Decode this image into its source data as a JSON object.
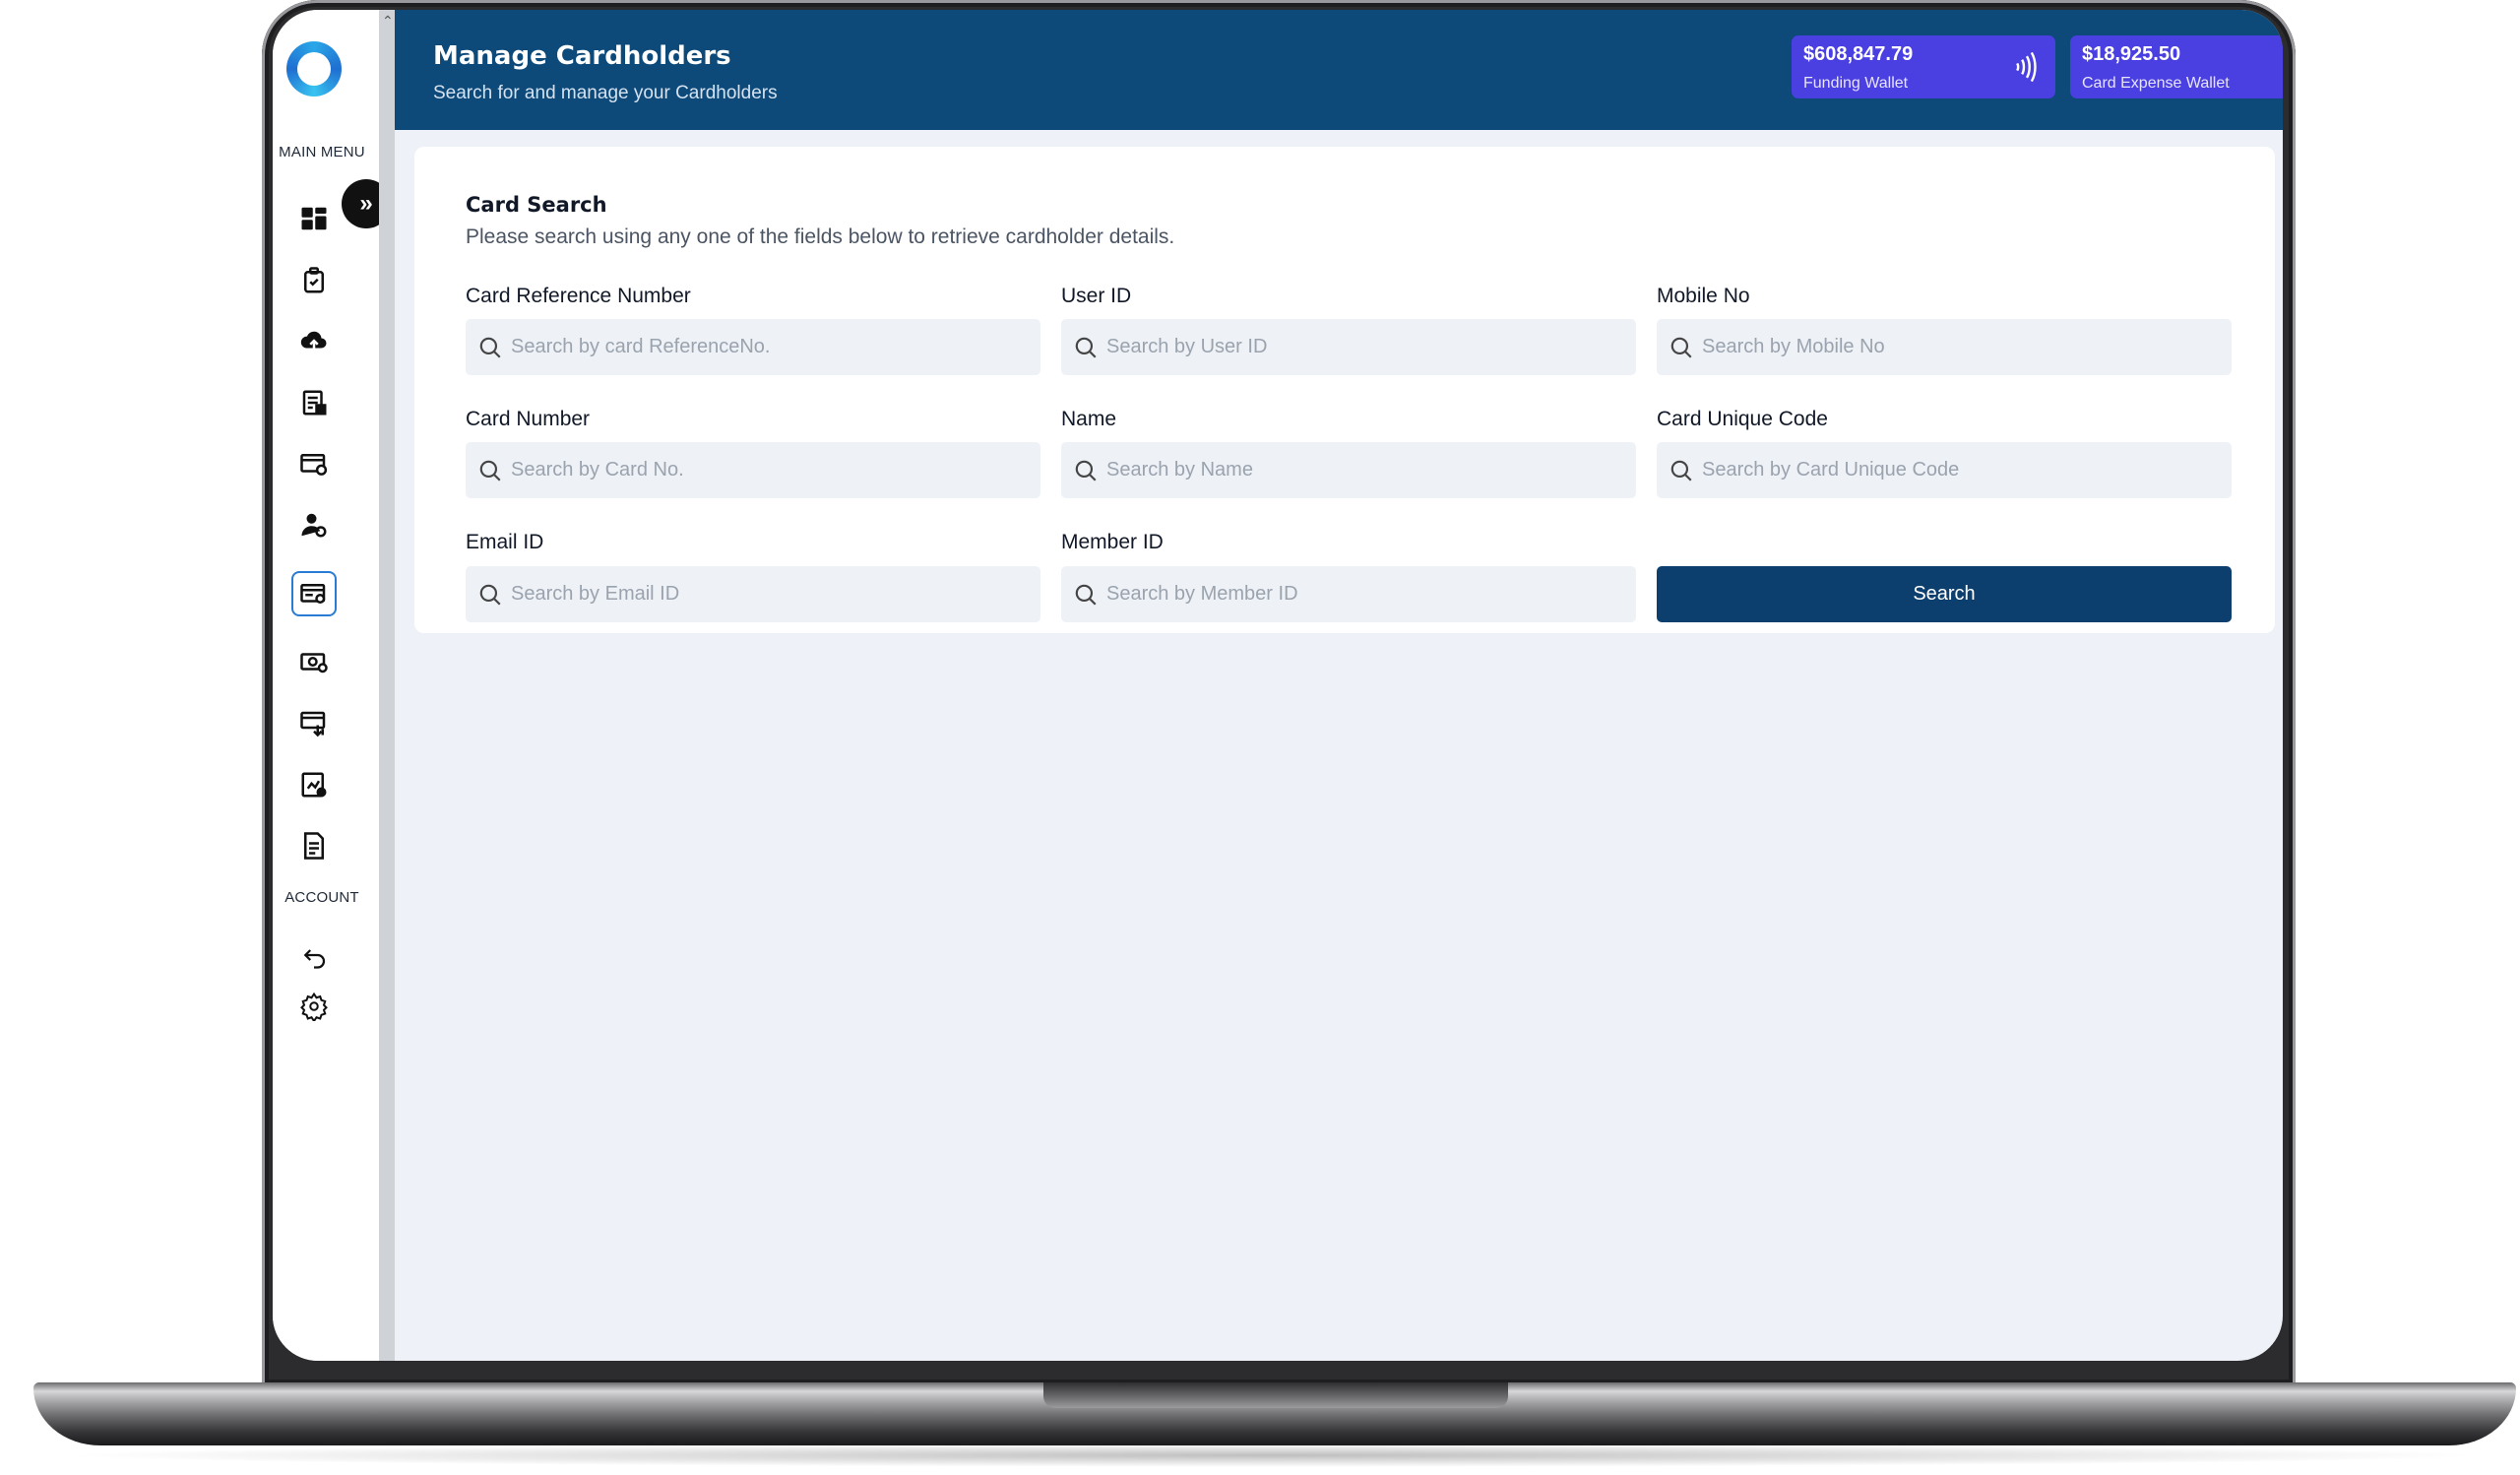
{
  "sidebar": {
    "main_menu_label": "MAIN MENU",
    "account_label": "ACCOUNT",
    "items": [
      {
        "icon": "dashboard-icon"
      },
      {
        "icon": "clipboard-check-icon"
      },
      {
        "icon": "cloud-upload-icon"
      },
      {
        "icon": "document-list-icon"
      },
      {
        "icon": "card-settings-icon"
      },
      {
        "icon": "user-settings-icon"
      },
      {
        "icon": "card-search-icon",
        "active": true
      },
      {
        "icon": "money-settings-icon"
      },
      {
        "icon": "card-transfer-icon"
      },
      {
        "icon": "report-settings-icon"
      },
      {
        "icon": "document-icon"
      }
    ],
    "account_items": [
      {
        "icon": "logout-icon"
      },
      {
        "icon": "settings-gear-icon"
      }
    ]
  },
  "header": {
    "title": "Manage Cardholders",
    "subtitle": "Search for and manage your Cardholders",
    "wallets": [
      {
        "amount": "$608,847.79",
        "label": "Funding Wallet",
        "icon": "contactless-icon"
      },
      {
        "amount": "$18,925.50",
        "label": "Card Expense Wallet",
        "icon": "contactless-icon"
      }
    ]
  },
  "card_search": {
    "title": "Card Search",
    "description": "Please search using any one of the fields below to retrieve cardholder details.",
    "fields": [
      {
        "label": "Card Reference Number",
        "placeholder": "Search by card ReferenceNo."
      },
      {
        "label": "User ID",
        "placeholder": "Search by User ID"
      },
      {
        "label": "Mobile No",
        "placeholder": "Search by Mobile No"
      },
      {
        "label": "Card Number",
        "placeholder": "Search by Card No."
      },
      {
        "label": "Name",
        "placeholder": "Search by Name"
      },
      {
        "label": "Card Unique Code",
        "placeholder": "Search by Card Unique Code"
      },
      {
        "label": "Email ID",
        "placeholder": "Search by Email ID"
      },
      {
        "label": "Member ID",
        "placeholder": "Search by Member ID"
      }
    ],
    "search_button": "Search"
  },
  "colors": {
    "header_bg": "#0d4a7a",
    "wallet_bg": "#4a3fe0",
    "button_bg": "#0d3f6e",
    "active_icon_border": "#2a7bd3"
  }
}
